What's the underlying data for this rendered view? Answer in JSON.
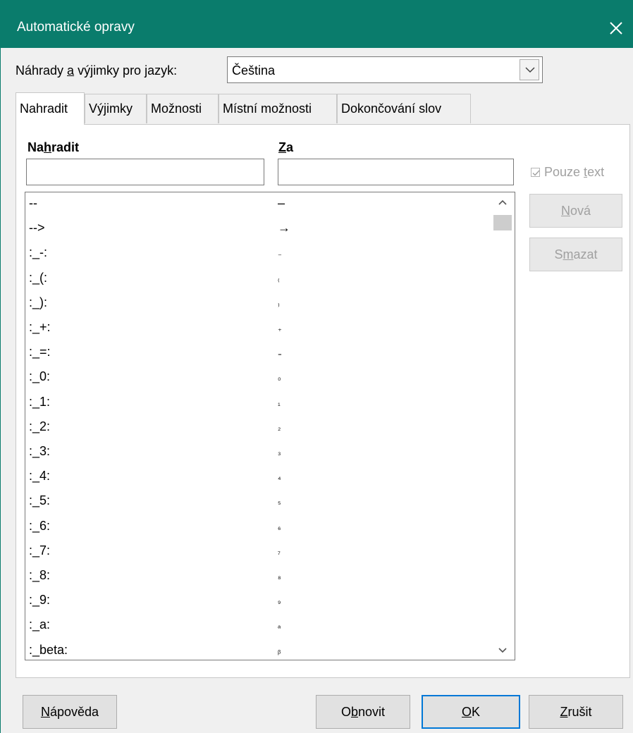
{
  "window": {
    "title": "Automatické opravy"
  },
  "language": {
    "label": "Náhrady a výjimky pro jazyk:",
    "value": "Čeština"
  },
  "tabs": [
    {
      "label": "Nahradit",
      "active": true
    },
    {
      "label": "Výjimky",
      "active": false
    },
    {
      "label": "Možnosti",
      "active": false
    },
    {
      "label": "Místní možnosti",
      "active": false
    },
    {
      "label": "Dokončování slov",
      "active": false
    }
  ],
  "replace": {
    "col_replace": "Nahradit",
    "col_with": "Za",
    "replace_value": "",
    "with_value": "",
    "text_only": {
      "label": "Pouze text",
      "checked": true,
      "enabled": false
    },
    "new_button": "Nová",
    "delete_button": "Smazat",
    "rows": [
      {
        "k": "--",
        "v": "–"
      },
      {
        "k": "-->",
        "v": "→"
      },
      {
        "k": ":_-:",
        "v": "₋"
      },
      {
        "k": ":_(:",
        "v": "₍"
      },
      {
        "k": ":_):",
        "v": "₎"
      },
      {
        "k": ":_+:",
        "v": "₊"
      },
      {
        "k": ":_=:",
        "v": "₌"
      },
      {
        "k": ":_0:",
        "v": "₀"
      },
      {
        "k": ":_1:",
        "v": "₁"
      },
      {
        "k": ":_2:",
        "v": "₂"
      },
      {
        "k": ":_3:",
        "v": "₃"
      },
      {
        "k": ":_4:",
        "v": "₄"
      },
      {
        "k": ":_5:",
        "v": "₅"
      },
      {
        "k": ":_6:",
        "v": "₆"
      },
      {
        "k": ":_7:",
        "v": "₇"
      },
      {
        "k": ":_8:",
        "v": "₈"
      },
      {
        "k": ":_9:",
        "v": "₉"
      },
      {
        "k": ":_a:",
        "v": "ₐ"
      },
      {
        "k": ":_beta:",
        "v": "ᵦ"
      }
    ]
  },
  "footer": {
    "help": "Nápověda",
    "reset": "Obnovit",
    "ok": "OK",
    "cancel": "Zrušit"
  },
  "icons": {
    "close": "close-icon",
    "dropdown": "chevron-down-icon",
    "scroll_up": "chevron-up-icon",
    "scroll_down": "chevron-down-icon",
    "check": "checkmark-icon"
  },
  "colors": {
    "titlebar": "#0a7c6c",
    "default_button_border": "#0078d7"
  }
}
